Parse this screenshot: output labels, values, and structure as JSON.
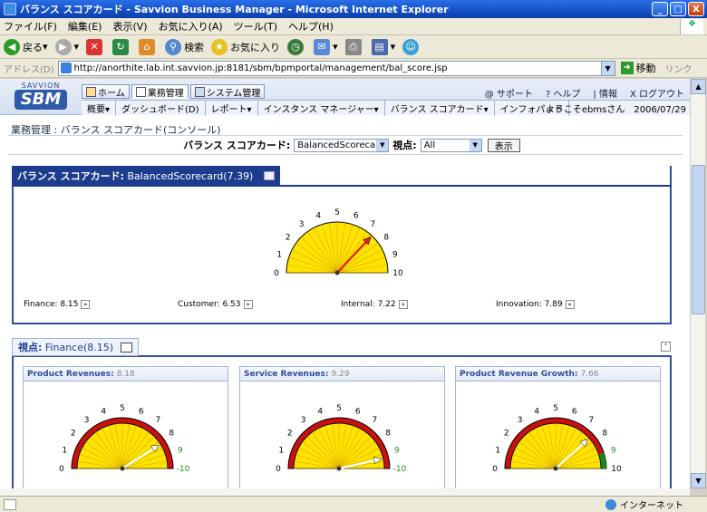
{
  "window": {
    "title": "バランス スコアカード - Savvion Business Manager - Microsoft Internet Explorer",
    "controls": [
      "_",
      "□",
      "X"
    ]
  },
  "menu": [
    "ファイル(F)",
    "編集(E)",
    "表示(V)",
    "お気に入り(A)",
    "ツール(T)",
    "ヘルプ(H)"
  ],
  "toolbar": {
    "back": "戻る",
    "search": "検索",
    "favorites": "お気に入り"
  },
  "address": {
    "label": "アドレス(D)",
    "url": "http://anorthite.lab.int.savvion.jp:8181/sbm/bpmportal/management/bal_score.jsp",
    "go": "移動",
    "links": "リンク"
  },
  "portal": {
    "logo_top": "SAVVION",
    "logo_main": "SBM",
    "tabs": [
      "ホーム",
      "業務管理",
      "システム管理"
    ],
    "active_tab": "業務管理",
    "top_links": [
      "@ サポート",
      "? ヘルプ",
      "| 情報",
      "X ログアウト"
    ],
    "subnav": [
      "概要▾",
      "ダッシュボード(D)",
      "レポート▾",
      "インスタンス マネージャー▾",
      "バランス スコアカード▾",
      "インフォパッド"
    ],
    "welcome": "ようこそebmsさん　2006/07/29"
  },
  "breadcrumb": "業務管理 : バランス スコアカード(コンソール)",
  "selector": {
    "scorecard_label": "バランス スコアカード:",
    "scorecard_value": "BalancedScorecard",
    "view_label": "視点:",
    "view_value": "All",
    "show_button": "表示"
  },
  "scorecard_panel": {
    "title": "バランス スコアカード:",
    "name": "BalancedScorecard(7.39)",
    "gauge_value": 7.39,
    "gauge_scale": [
      "0",
      "1",
      "2",
      "3",
      "4",
      "5",
      "6",
      "7",
      "8",
      "9",
      "10"
    ],
    "metrics": [
      {
        "label": "Finance:",
        "value": "8.15"
      },
      {
        "label": "Customer:",
        "value": "6.53"
      },
      {
        "label": "Internal:",
        "value": "7.22"
      },
      {
        "label": "Innovation:",
        "value": "7.89"
      }
    ]
  },
  "perspective_panel": {
    "title": "視点:",
    "name": "Finance(8.15)",
    "cards": [
      {
        "title": "Product Revenues:",
        "value": "8.18",
        "gauge_value": 8.18,
        "upper_label": "-10"
      },
      {
        "title": "Service Revenues:",
        "value": "9.29",
        "gauge_value": 9.29,
        "upper_label": "-10"
      },
      {
        "title": "Product Revenue Growth:",
        "value": "7.66",
        "gauge_value": 7.66,
        "upper_label": "10"
      }
    ]
  },
  "status": {
    "zone": "インターネット"
  },
  "colors": {
    "title_bar": "#1550c6",
    "panel_border": "#2f4f9c",
    "gauge_fill": "#ffe400",
    "gauge_red": "#cc1010",
    "gauge_green": "#1a8a1a"
  }
}
